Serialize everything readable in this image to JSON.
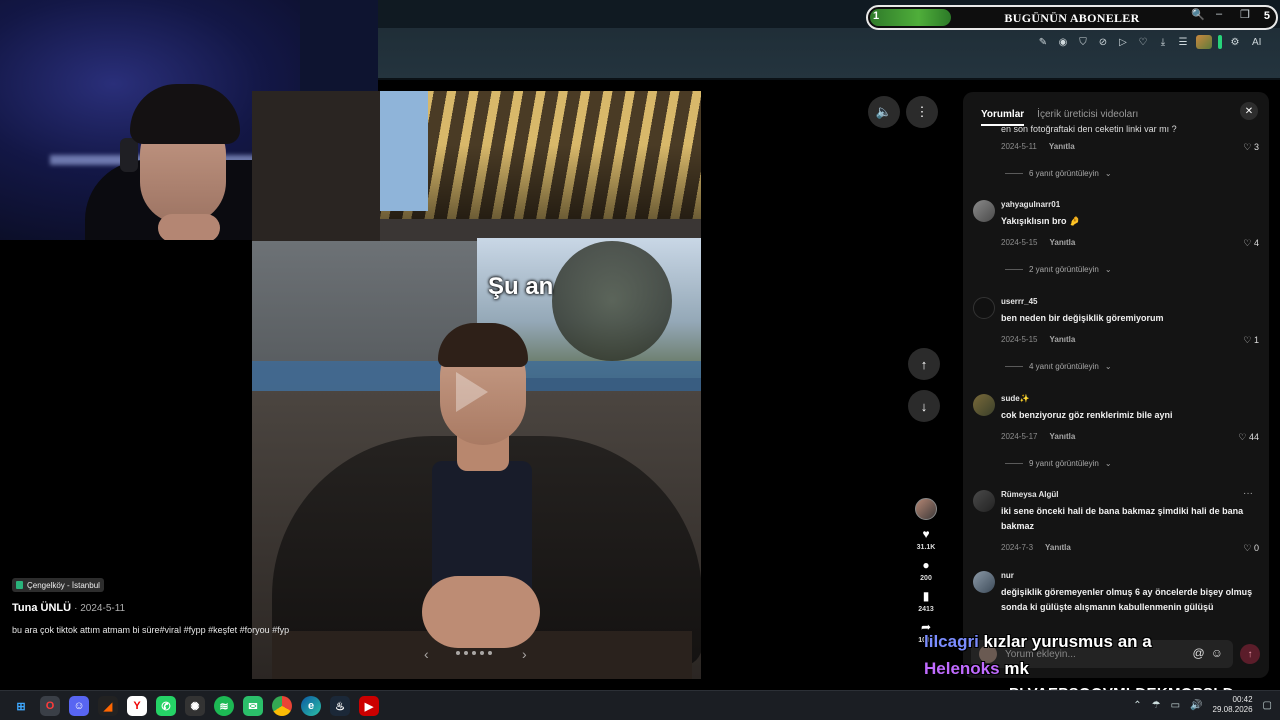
{
  "goal": {
    "start": "1",
    "title": "BUGÜNÜN ABONELER",
    "end": "5",
    "progress": 0.2,
    "fill_color": "#4fae3a"
  },
  "window_controls": {
    "search_icon": "search-icon",
    "minimize": "–",
    "maximize": "❐",
    "close": "✕"
  },
  "extensions": {
    "ai_label": "AI"
  },
  "video": {
    "caption": "Şu an",
    "location": "Çengelköy - İstanbul",
    "author": "Tuna ÜNLÜ",
    "date": "2024-5-11",
    "description": "bu ara çok tiktok attım atmam bi süre#viral #fypp #keşfet #foryou #fyp"
  },
  "actions": {
    "likes": "31.1K",
    "comments": "200",
    "bookmarks": "2413",
    "shares": "1097"
  },
  "comments_panel": {
    "tabs": [
      "Yorumlar",
      "İçerik üreticisi videoları"
    ],
    "cut_text": "en son fotoğraftaki den ceketin linki var mı ?",
    "first_meta": {
      "date": "2024-5-11",
      "reply": "Yanıtla",
      "likes": "3"
    },
    "first_replies": "6 yanıt görüntüleyin",
    "comments": [
      {
        "user": "yahyagulnarr01",
        "text": "Yakışıklısın bro 🤌",
        "date": "2024-5-15",
        "reply": "Yanıtla",
        "likes": "4",
        "replies": "2 yanıt görüntüleyin"
      },
      {
        "user": "userrr_45",
        "text": "ben neden bir değişiklik göremiyorum",
        "date": "2024-5-15",
        "reply": "Yanıtla",
        "likes": "1",
        "replies": "4 yanıt görüntüleyin"
      },
      {
        "user": "sude✨",
        "text": "cok benziyoruz göz renklerimiz bile ayni",
        "date": "2024-5-17",
        "reply": "Yanıtla",
        "likes": "44",
        "replies": "9 yanıt görüntüleyin"
      },
      {
        "user": "Rümeysa Algül",
        "text": "iki sene önceki hali de bana bakmaz şimdiki hali de bana bakmaz",
        "date": "2024-7-3",
        "reply": "Yanıtla",
        "likes": "0",
        "replies": ""
      },
      {
        "user": "nur",
        "text": "değişiklik göremeyenler olmuş 6 ay öncelerde bişey olmuş sonda ki gülüşte alışmanın kabullenmenin gülüşü",
        "date": "",
        "reply": "",
        "likes": "",
        "replies": ""
      }
    ],
    "input_placeholder": "Yorum ekleyin..."
  },
  "chat": [
    {
      "user": "lilcagri",
      "message": "kızlar yurusmus an a"
    },
    {
      "user": "Helenoks",
      "message": "mk"
    }
  ],
  "channel_tag": "PLVAEPŞQOVMLDEKMOPŞLD",
  "taskbar": {
    "apps": [
      "windows-start",
      "opera-gx",
      "discord",
      "chrome-dark",
      "yandex",
      "whatsapp",
      "davinci",
      "spotify",
      "whatsapp-alt",
      "google-chrome",
      "edge",
      "steam",
      "media-player"
    ],
    "time": "00:42",
    "date": "29.08.2026"
  }
}
